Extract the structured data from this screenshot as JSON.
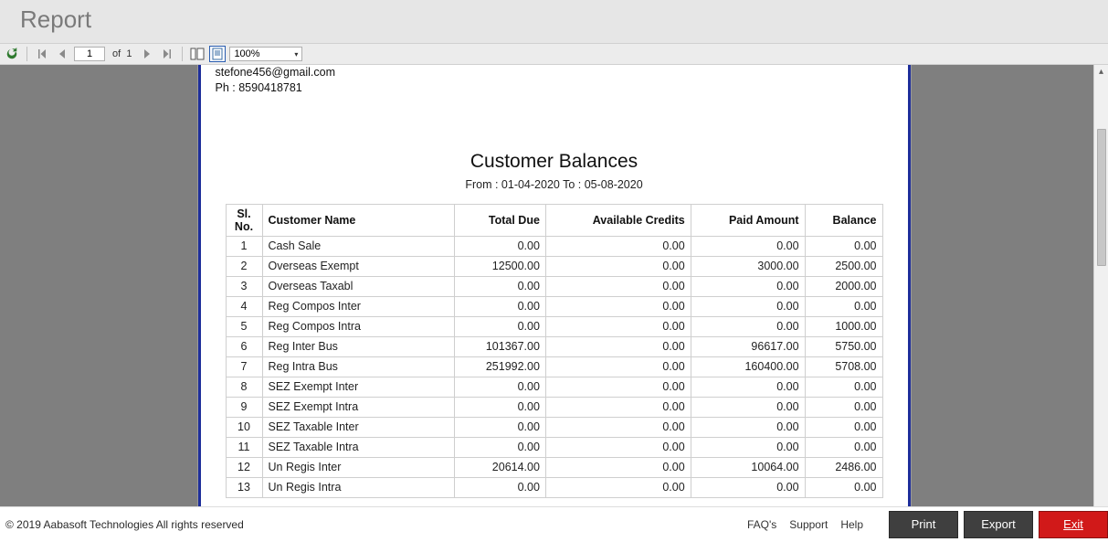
{
  "window": {
    "title": "Report"
  },
  "toolbar": {
    "current_page": "1",
    "of_label": "of",
    "total_pages": "1",
    "zoom": "100%"
  },
  "org": {
    "email": "stefone456@gmail.com",
    "phone_label": "Ph :",
    "phone": "8590418781"
  },
  "report": {
    "title": "Customer Balances",
    "date_range": "From : 01-04-2020 To : 05-08-2020"
  },
  "columns": {
    "sl": "Sl. No.",
    "name": "Customer Name",
    "due": "Total Due",
    "credits": "Available Credits",
    "paid": "Paid Amount",
    "balance": "Balance"
  },
  "rows": [
    {
      "sl": "1",
      "name": "Cash Sale",
      "due": "0.00",
      "credits": "0.00",
      "paid": "0.00",
      "balance": "0.00"
    },
    {
      "sl": "2",
      "name": "Overseas Exempt",
      "due": "12500.00",
      "credits": "0.00",
      "paid": "3000.00",
      "balance": "2500.00"
    },
    {
      "sl": "3",
      "name": "Overseas Taxabl",
      "due": "0.00",
      "credits": "0.00",
      "paid": "0.00",
      "balance": "2000.00"
    },
    {
      "sl": "4",
      "name": "Reg Compos Inter",
      "due": "0.00",
      "credits": "0.00",
      "paid": "0.00",
      "balance": "0.00"
    },
    {
      "sl": "5",
      "name": "Reg Compos Intra",
      "due": "0.00",
      "credits": "0.00",
      "paid": "0.00",
      "balance": "1000.00"
    },
    {
      "sl": "6",
      "name": "Reg Inter Bus",
      "due": "101367.00",
      "credits": "0.00",
      "paid": "96617.00",
      "balance": "5750.00"
    },
    {
      "sl": "7",
      "name": "Reg Intra Bus",
      "due": "251992.00",
      "credits": "0.00",
      "paid": "160400.00",
      "balance": "5708.00"
    },
    {
      "sl": "8",
      "name": "SEZ Exempt Inter",
      "due": "0.00",
      "credits": "0.00",
      "paid": "0.00",
      "balance": "0.00"
    },
    {
      "sl": "9",
      "name": "SEZ Exempt Intra",
      "due": "0.00",
      "credits": "0.00",
      "paid": "0.00",
      "balance": "0.00"
    },
    {
      "sl": "10",
      "name": "SEZ Taxable Inter",
      "due": "0.00",
      "credits": "0.00",
      "paid": "0.00",
      "balance": "0.00"
    },
    {
      "sl": "11",
      "name": "SEZ Taxable Intra",
      "due": "0.00",
      "credits": "0.00",
      "paid": "0.00",
      "balance": "0.00"
    },
    {
      "sl": "12",
      "name": "Un Regis Inter",
      "due": "20614.00",
      "credits": "0.00",
      "paid": "10064.00",
      "balance": "2486.00"
    },
    {
      "sl": "13",
      "name": "Un Regis Intra",
      "due": "0.00",
      "credits": "0.00",
      "paid": "0.00",
      "balance": "0.00"
    }
  ],
  "footer": {
    "copyright": "© 2019 Aabasoft Technologies All rights reserved",
    "links": {
      "faqs": "FAQ's",
      "support": "Support",
      "help": "Help"
    },
    "buttons": {
      "print": "Print",
      "export": "Export",
      "exit": "Exit"
    }
  }
}
